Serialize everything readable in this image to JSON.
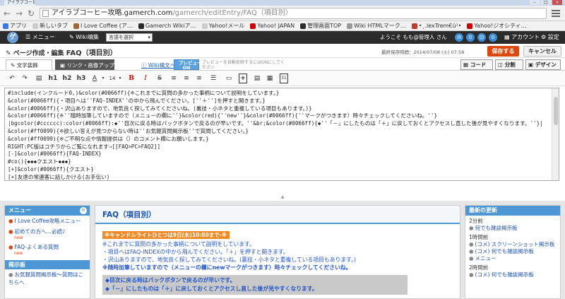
{
  "browser": {
    "tab_title": "アイラブコーヒー攻略.gamerch.com",
    "url_domain": "アイラブコーヒー攻略.gamerch.com",
    "url_path": "/gamerch/editEntry/FAQ（項目別）",
    "bookmarks": [
      {
        "label": "アプリ",
        "icon": "apps-icon",
        "color": "#3b78e7"
      },
      {
        "label": "新しいタブ",
        "icon": "page-icon",
        "color": "#cccccc"
      },
      {
        "label": "I Love Coffee (ア…",
        "icon": "page-icon",
        "color": "#9b6a3c"
      },
      {
        "label": "Gamerch Wikiア…",
        "icon": "page-icon",
        "color": "#2b2b2b"
      },
      {
        "label": "Yahoo!メール",
        "icon": "mail-icon",
        "color": "#cccccc"
      },
      {
        "label": "Yahoo! JAPAN",
        "icon": "page-icon",
        "color": "#cc0000"
      },
      {
        "label": "管理画面TOP",
        "icon": "page-icon",
        "color": "#2b2b2b"
      },
      {
        "label": "Wiki HTMLマーク…",
        "icon": "page-icon",
        "color": "#999999"
      },
      {
        "label": "•¸.lexTrem€ú¹•",
        "icon": "page-icon",
        "color": "#c0392b"
      },
      {
        "label": "Yahoo!ジオシティ…",
        "icon": "page-icon",
        "color": "#cc0000"
      }
    ]
  },
  "header": {
    "logo": "ゲ",
    "menu_label": "メニュー",
    "wiki_label": "Wiki编集",
    "lang_select": "言語を選択",
    "welcome": "ようこそ もも@管理人 さん",
    "account_label": "アカウント",
    "settings_label": "設定"
  },
  "toolbar": {
    "page_section": "ページ作成・編集",
    "page_name": "FAQ（項目別）",
    "last_saved": "最終保存時間：2014/07/08 (火) 07:58",
    "save_label": "保存する",
    "cancel_label": "キャンセル"
  },
  "editor_tabs": {
    "text_deco": "文字装飾",
    "link_image": "リンク・画像アップ",
    "wiki_help": "Wiki構文ヘルプ",
    "preview_top": "プレビュー",
    "preview_bottom": "ON",
    "preview_hint": "プレビューを自動反映するにはONにしてください",
    "code": "コード",
    "split": "分割",
    "design": "デザイン"
  },
  "format_buttons": [
    "↶",
    "↷",
    "h1",
    "h2",
    "h3",
    "A",
    "14",
    "B",
    "I",
    "S"
  ],
  "editor": {
    "lines": [
      "#include(インクルード0,)&color(#0066ff){※これまでに質問の多かった事柄について説明をしています。}",
      "&color(#0066ff){・項目へは''FAQ-INDEX''の中から飛んでください。[''＋'']を押すと開きます。}",
      "&color(#0066ff){・沢山ありますので、地気良く探してみてくださいね。(裏技・小ネタと重複している項目もあります。)}",
      "&color(#0066ff){※''随時加筆していますので（メニューの欄に''}&color(red){''new''}&color(#0066ff){''マークがつきます）時々チェックしてくださいね。''}",
      "|bgcolor(#cccccc):color(#0066ff):◆''目次に戻る時はバックボタンで戻るのが早いです。''&br;&color(#0066ff){◆''「－」にしたものは「＋」に戻しておくとアクセスし直した後が見やすくなります。''}|",
      "&color(#ff0099){※欲しい答えが見つからない時は''お気軽質問掲示板''で質問してください。}",
      "&color(#ff0099){※ご不明な点や情報提供は（）のコメント欄にお願いします。}",
      "RIGHT:PC版はコチラからご覧になれます⇒[[FAQ>PC>FAQ2]]",
      "[-]&color(#0066ff){FAQ-INDEX}",
      "#co(){◆◆◆クエスト◆◆◆}",
      "[+]&color(#0066ff){クエスト}",
      "[+]友達の常連客に話しかける(お手伝い)"
    ]
  },
  "left_menu": {
    "title": "メニュー",
    "items": [
      {
        "label": "I Love Coffee攻略メニュー",
        "sub": ""
      },
      {
        "label": "初めての方へ…必読♪",
        "sub": "new"
      },
      {
        "label": "FAQ-よくある質問",
        "sub": "new"
      }
    ],
    "board_title": "掲示板",
    "board_items": [
      "お気軽質問掲示板～質問はこちらへ"
    ]
  },
  "article": {
    "title": "FAQ（項目別）",
    "notice": "※キャンドルライトひとつは9日(水)10:00まで-※",
    "lines": [
      "※これまでに質問の多かった事柄について説明をしています。",
      "・項目へはFAQ-INDEXの中から飛んでください。「＋」を押すと開きます。",
      "・沢山ありますので、地気良く探してみてくださいね。(裏技・小ネタと重複している項目もあります。)",
      "※随時加筆していますので（メニューの欄にnewマークがつきます）時々チェックしてくださいね。"
    ],
    "box_lines": [
      "◆目次に戻る時はバックボタンで戻るのが早いです。",
      "◆「－」にしたものは「＋」に戻しておくとアクセスし直した後が見やすくなります。"
    ]
  },
  "updates": {
    "title": "最新の更新",
    "groups": [
      {
        "time": "2分前",
        "items": [
          "何でも雑談掲示板"
        ]
      },
      {
        "time": "1時間前",
        "items": [
          "(コメ) スクリーンショット掲示板",
          "(コメ) 何でも雑談掲示板",
          "メニュー"
        ]
      },
      {
        "time": "2時間前",
        "items": [
          "(コメ) 何でも雑談掲示板"
        ]
      }
    ]
  }
}
